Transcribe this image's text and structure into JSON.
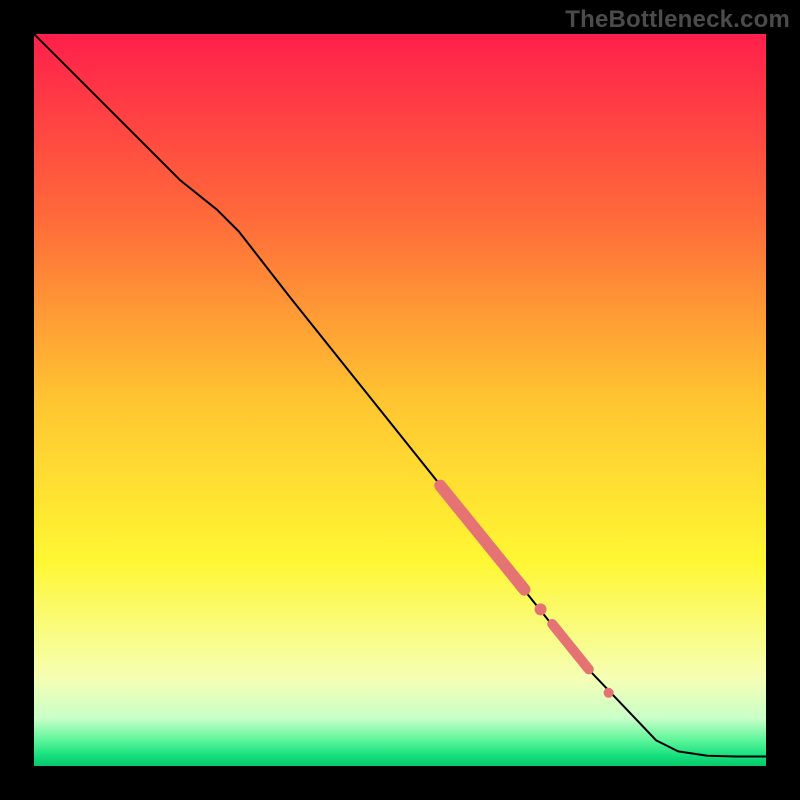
{
  "watermark": "TheBottleneck.com",
  "chart_data": {
    "type": "line",
    "title": "",
    "xlabel": "",
    "ylabel": "",
    "xlim": [
      0,
      100
    ],
    "ylim": [
      0,
      100
    ],
    "grid": false,
    "legend": false,
    "gradient_stops": [
      {
        "offset": 0.0,
        "color": "#ff1f4b"
      },
      {
        "offset": 0.25,
        "color": "#ff6a3a"
      },
      {
        "offset": 0.5,
        "color": "#ffc531"
      },
      {
        "offset": 0.72,
        "color": "#fff733"
      },
      {
        "offset": 0.88,
        "color": "#f6ffb4"
      },
      {
        "offset": 0.935,
        "color": "#c8ffc8"
      },
      {
        "offset": 0.965,
        "color": "#5cf59a"
      },
      {
        "offset": 0.985,
        "color": "#18e07e"
      },
      {
        "offset": 1.0,
        "color": "#05c968"
      }
    ],
    "series": [
      {
        "name": "curve",
        "color": "#000000",
        "width": 2,
        "x": [
          0,
          5,
          10,
          15,
          20,
          25,
          28,
          35,
          45,
          55,
          65,
          75,
          85,
          88,
          92,
          96,
          100
        ],
        "y": [
          100,
          95,
          90,
          85,
          80,
          76,
          73,
          64,
          51.5,
          39,
          26.5,
          14,
          3.5,
          2.0,
          1.4,
          1.3,
          1.3
        ]
      }
    ],
    "markers": [
      {
        "name": "band-1",
        "shape": "capsule",
        "color": "#e57373",
        "width": 12,
        "x": [
          55.5,
          67.0
        ],
        "y": [
          38.3,
          24.1
        ]
      },
      {
        "name": "dot-1",
        "shape": "dot",
        "color": "#e57373",
        "r": 6,
        "x": 69.2,
        "y": 21.4
      },
      {
        "name": "band-2",
        "shape": "capsule",
        "color": "#e57373",
        "width": 10,
        "x": [
          70.8,
          75.8
        ],
        "y": [
          19.4,
          13.2
        ]
      },
      {
        "name": "dot-2",
        "shape": "dot",
        "color": "#e57373",
        "r": 5,
        "x": 78.5,
        "y": 10.0
      }
    ]
  }
}
